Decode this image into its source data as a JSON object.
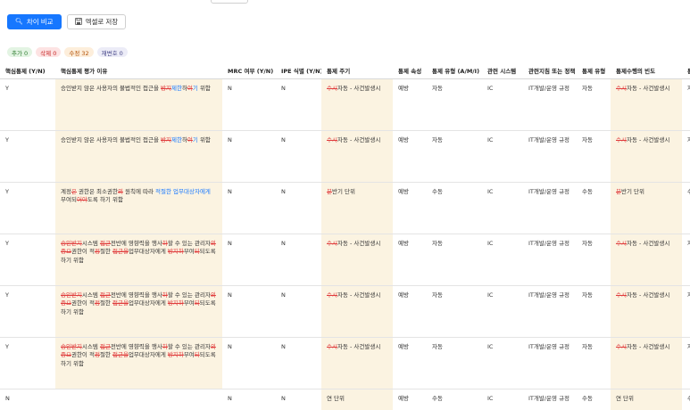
{
  "toolbar": {
    "compare_label": "차이 비교",
    "excel_label": "엑셀로 저장"
  },
  "badges": {
    "add": "추가 0",
    "del": "삭제 0",
    "mod": "수정 32",
    "rev": "재변호 0"
  },
  "table": {
    "columns": [
      "핵심통제 (Y/N)",
      "핵심통제 평가 이유",
      "MRC 여부 (Y/N)",
      "IPE 식별 (Y/N)",
      "통제 주기",
      "통제 속성",
      "통제 유형 (A/M/I)",
      "관련 시스템",
      "관련지침 또는 정책",
      "통제 유형",
      "통제수행의 빈도",
      "통"
    ],
    "rows": [
      {
        "key": "Y",
        "reason": [
          {
            "t": "승인받지 않은 사용자의 불법적인 접근을 "
          },
          {
            "t": "방지",
            "s": "del"
          },
          {
            "t": "제한",
            "s": "ins"
          },
          {
            "t": "하"
          },
          {
            "t": "여",
            "s": "del"
          },
          {
            "t": "기",
            "s": "ins"
          },
          {
            "t": " 위함"
          }
        ],
        "mrc": "N",
        "ipe": "N",
        "cycle": [
          {
            "t": "수시",
            "s": "del"
          },
          {
            "t": "자동 - 사건발생시"
          }
        ],
        "attr": "예방",
        "ctype": "자동",
        "system": "IC",
        "policy": "IT개발/운영 규정",
        "ctype2": "자동",
        "freq": [
          {
            "t": "수시",
            "s": "del"
          },
          {
            "t": "자동 - 사건발생시"
          }
        ],
        "last": "자"
      },
      {
        "key": "Y",
        "reason": [
          {
            "t": "승인받지 않은 사용자의 불법적인 접근을 "
          },
          {
            "t": "방지",
            "s": "del"
          },
          {
            "t": "제한",
            "s": "ins"
          },
          {
            "t": "하"
          },
          {
            "t": "여",
            "s": "del"
          },
          {
            "t": "기",
            "s": "ins"
          },
          {
            "t": " 위함"
          }
        ],
        "mrc": "N",
        "ipe": "N",
        "cycle": [
          {
            "t": "수시",
            "s": "del"
          },
          {
            "t": "자동 - 사건발생시"
          }
        ],
        "attr": "예방",
        "ctype": "자동",
        "system": "IC",
        "policy": "IT개발/운영 규정",
        "ctype2": "자동",
        "freq": [
          {
            "t": "수시",
            "s": "del"
          },
          {
            "t": "자동 - 사건발생시"
          }
        ],
        "last": "자"
      },
      {
        "key": "Y",
        "reason": [
          {
            "t": "계정"
          },
          {
            "t": "은",
            "s": "del"
          },
          {
            "t": " 권한은 최소권한"
          },
          {
            "t": "의",
            "s": "del"
          },
          {
            "t": " 원칙에 따라 "
          },
          {
            "t": "적절한 업무대상자에게",
            "s": "ins"
          },
          {
            "t": " 부여되"
          },
          {
            "t": "어야",
            "s": "del"
          },
          {
            "t": "도록 하기 위함"
          }
        ],
        "mrc": "N",
        "ipe": "N",
        "cycle": [
          {
            "t": "분",
            "s": "del"
          },
          {
            "t": "반기 단위"
          }
        ],
        "attr": "예방",
        "ctype": "수동",
        "system": "IC",
        "policy": "IT개발/운영 규정",
        "ctype2": "수동",
        "freq": [
          {
            "t": "분",
            "s": "del"
          },
          {
            "t": "반기 단위"
          }
        ],
        "last": "수"
      },
      {
        "key": "Y",
        "reason": [
          {
            "t": "승인받지",
            "s": "del"
          },
          {
            "t": "시스템 "
          },
          {
            "t": "접근",
            "s": "del"
          },
          {
            "t": "전반에 영향력을 행사"
          },
          {
            "t": "하",
            "s": "del"
          },
          {
            "t": "할 수 있는 관리자"
          },
          {
            "t": "의",
            "s": "del"
          },
          {
            "t": " "
          },
          {
            "t": "중요",
            "s": "del"
          },
          {
            "t": "권한이 적"
          },
          {
            "t": "정",
            "s": "del"
          },
          {
            "t": "절한 "
          },
          {
            "t": "접근을",
            "s": "del"
          },
          {
            "t": "업무대상자에게 "
          },
          {
            "t": "방지하",
            "s": "del"
          },
          {
            "t": "부여"
          },
          {
            "t": "되",
            "s": "del"
          },
          {
            "t": "되도록 하기 위함"
          }
        ],
        "mrc": "N",
        "ipe": "N",
        "cycle": [
          {
            "t": "수시",
            "s": "del"
          },
          {
            "t": "자동 - 사건발생시"
          }
        ],
        "attr": "예방",
        "ctype": "자동",
        "system": "IC",
        "policy": "IT개발/운영 규정",
        "ctype2": "자동",
        "freq": [
          {
            "t": "수시",
            "s": "del"
          },
          {
            "t": "자동 - 사건발생시"
          }
        ],
        "last": "자"
      },
      {
        "key": "Y",
        "reason": [
          {
            "t": "승인받지",
            "s": "del"
          },
          {
            "t": "시스템 "
          },
          {
            "t": "접근",
            "s": "del"
          },
          {
            "t": "전반에 영향력을 행사"
          },
          {
            "t": "하",
            "s": "del"
          },
          {
            "t": "할 수 있는 관리자"
          },
          {
            "t": "의",
            "s": "del"
          },
          {
            "t": " "
          },
          {
            "t": "중요",
            "s": "del"
          },
          {
            "t": "권한이 적"
          },
          {
            "t": "정",
            "s": "del"
          },
          {
            "t": "절한 "
          },
          {
            "t": "접근을",
            "s": "del"
          },
          {
            "t": "업무대상자에게 "
          },
          {
            "t": "방지하",
            "s": "del"
          },
          {
            "t": "부여"
          },
          {
            "t": "되",
            "s": "del"
          },
          {
            "t": "되도록 하기 위함"
          }
        ],
        "mrc": "N",
        "ipe": "N",
        "cycle": [
          {
            "t": "수시",
            "s": "del"
          },
          {
            "t": "자동 - 사건발생시"
          }
        ],
        "attr": "예방",
        "ctype": "자동",
        "system": "IC",
        "policy": "IT개발/운영 규정",
        "ctype2": "자동",
        "freq": [
          {
            "t": "수시",
            "s": "del"
          },
          {
            "t": "자동 - 사건발생시"
          }
        ],
        "last": "자"
      },
      {
        "key": "Y",
        "reason": [
          {
            "t": "승인받지",
            "s": "del"
          },
          {
            "t": "시스템 "
          },
          {
            "t": "접근",
            "s": "del"
          },
          {
            "t": "전반에 영향력을 행사"
          },
          {
            "t": "하",
            "s": "del"
          },
          {
            "t": "할 수 있는 관리자"
          },
          {
            "t": "의",
            "s": "del"
          },
          {
            "t": " "
          },
          {
            "t": "중요",
            "s": "del"
          },
          {
            "t": "권한이 적"
          },
          {
            "t": "정",
            "s": "del"
          },
          {
            "t": "절한 "
          },
          {
            "t": "접근을",
            "s": "del"
          },
          {
            "t": "업무대상자에게 "
          },
          {
            "t": "방지하",
            "s": "del"
          },
          {
            "t": "부여"
          },
          {
            "t": "되",
            "s": "del"
          },
          {
            "t": "되도록 하기 위함"
          }
        ],
        "mrc": "N",
        "ipe": "N",
        "cycle": [
          {
            "t": "수시",
            "s": "del"
          },
          {
            "t": "자동 - 사건발생시"
          }
        ],
        "attr": "예방",
        "ctype": "자동",
        "system": "IC",
        "policy": "IT개발/운영 규정",
        "ctype2": "자동",
        "freq": [
          {
            "t": "수시",
            "s": "del"
          },
          {
            "t": "자동 - 사건발생시"
          }
        ],
        "last": "자"
      },
      {
        "key": "N",
        "reason": [],
        "mrc": "N",
        "ipe": "N",
        "cycle": [
          {
            "t": "연 단위"
          }
        ],
        "attr": "예방",
        "ctype": "수동",
        "system": "IC",
        "policy": "IT개발/운영 규정",
        "ctype2": "수동",
        "freq": [
          {
            "t": "연 단위"
          }
        ],
        "last": "수"
      }
    ]
  }
}
